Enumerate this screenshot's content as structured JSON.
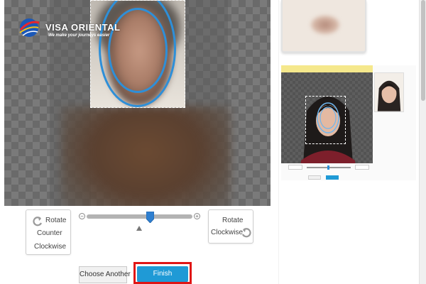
{
  "brand": {
    "name": "VISA ORIENTAL",
    "tagline": "We make your journeys easier"
  },
  "editor": {
    "zoom": 0.6
  },
  "controls": {
    "rotate_ccw": {
      "line1": "Rotate",
      "line2": "Counter",
      "line3": "Clockwise"
    },
    "rotate_cw": {
      "line1": "Rotate",
      "line2": "Clockwise"
    },
    "zoom_minus": "−",
    "zoom_plus": "+",
    "choose_another": "Choose Another",
    "finish": "Finish"
  },
  "colors": {
    "accent": "#1f9ad6",
    "guide_oval": "#2e8fd8",
    "highlight": "#e01515"
  },
  "icons": {
    "rotate_ccw": "rotate-counter-clockwise-icon",
    "rotate_cw": "rotate-clockwise-icon",
    "zoom_minus": "zoom-out-icon",
    "zoom_plus": "zoom-in-icon"
  }
}
